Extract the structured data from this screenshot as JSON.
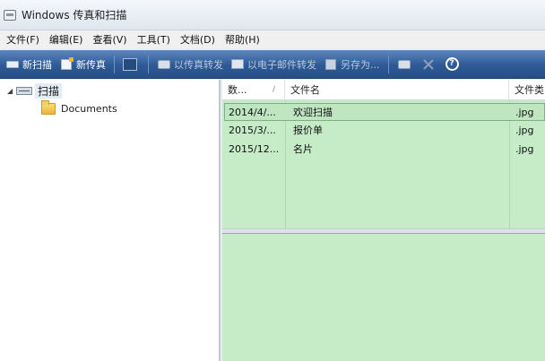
{
  "window": {
    "title": "Windows 传真和扫描"
  },
  "menu": [
    "文件(F)",
    "编辑(E)",
    "查看(V)",
    "工具(T)",
    "文档(D)",
    "帮助(H)"
  ],
  "toolbar": {
    "new_scan": "新扫描",
    "new_fax": "新传真",
    "forward_fax": "以传真转发",
    "forward_email": "以电子邮件转发",
    "save_as": "另存为...",
    "help_glyph": "?"
  },
  "tree": {
    "root": "扫描",
    "child": "Documents"
  },
  "list": {
    "columns": [
      "数...",
      "文件名",
      "文件类"
    ],
    "sort_glyph": "/",
    "rows": [
      {
        "date": "2014/4/...",
        "name": "欢迎扫描",
        "type": ".jpg"
      },
      {
        "date": "2015/3/...",
        "name": "报价单",
        "type": ".jpg"
      },
      {
        "date": "2015/12...",
        "name": "名片",
        "type": ".jpg"
      }
    ]
  },
  "colors": {
    "toolbar": "#2d5a96",
    "list_background": "#c5ecc7"
  }
}
